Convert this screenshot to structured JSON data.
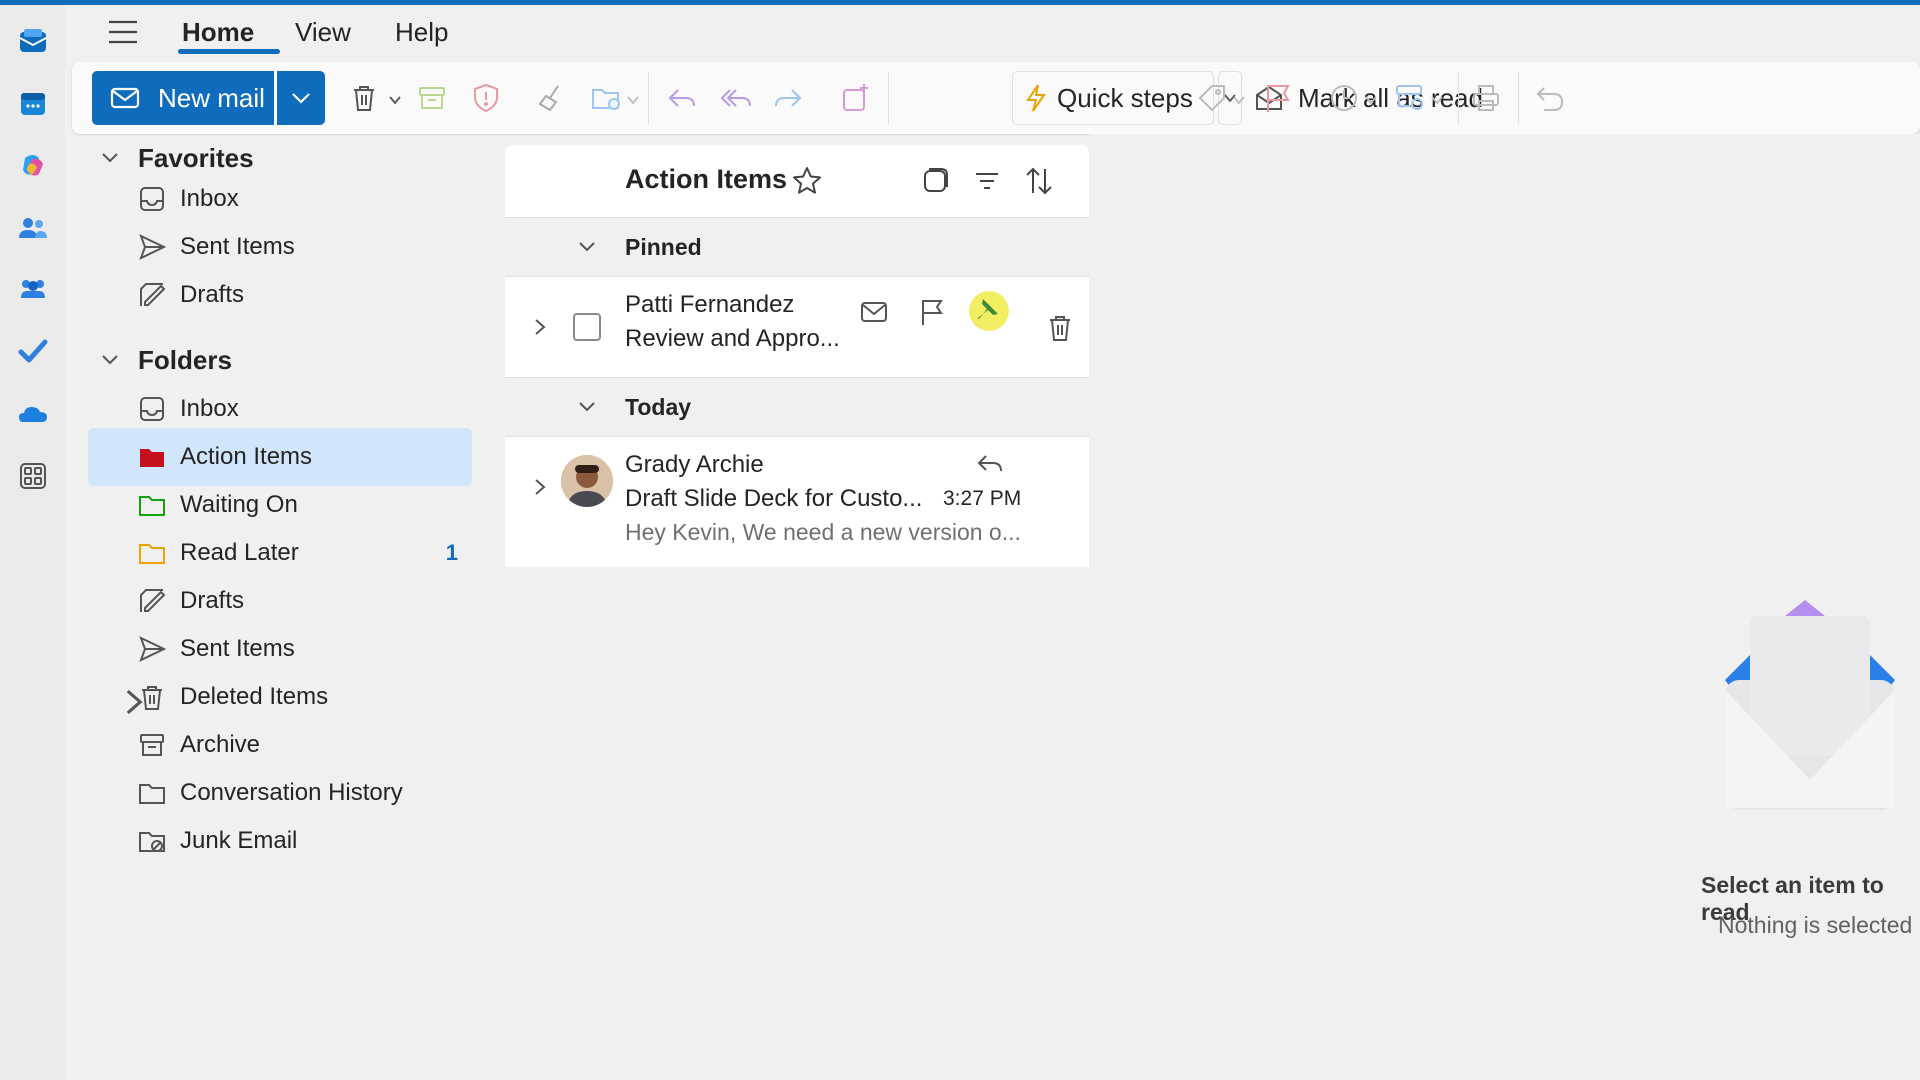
{
  "colors": {
    "accent": "#0f6cbd",
    "selected_bg": "#d1e5fb",
    "action_folder": "#c50f1f",
    "waiting_folder": "#13a10e",
    "later_folder": "#eaa300"
  },
  "rail": {
    "apps": [
      "mail-icon",
      "calendar-icon",
      "copilot-icon",
      "people-icon",
      "teams-icon",
      "todo-icon",
      "onedrive-icon",
      "more-apps-icon"
    ]
  },
  "header": {
    "tabs": [
      {
        "label": "Home",
        "active": true
      },
      {
        "label": "View",
        "active": false
      },
      {
        "label": "Help",
        "active": false
      }
    ]
  },
  "ribbon": {
    "new_mail_label": "New mail",
    "quick_steps_label": "Quick steps",
    "mark_all_read_label": "Mark all as read"
  },
  "favorites": {
    "header": "Favorites",
    "items": [
      {
        "label": "Inbox",
        "icon": "inbox-icon"
      },
      {
        "label": "Sent Items",
        "icon": "send-icon"
      },
      {
        "label": "Drafts",
        "icon": "drafts-icon"
      }
    ]
  },
  "folders": {
    "header": "Folders",
    "items": [
      {
        "label": "Inbox",
        "icon": "inbox-icon"
      },
      {
        "label": "Action Items",
        "icon": "folder-icon",
        "selected": true
      },
      {
        "label": "Waiting On",
        "icon": "folder-icon"
      },
      {
        "label": "Read Later",
        "icon": "folder-icon",
        "count": "1"
      },
      {
        "label": "Drafts",
        "icon": "drafts-icon"
      },
      {
        "label": "Sent Items",
        "icon": "send-icon"
      },
      {
        "label": "Deleted Items",
        "icon": "trash-icon"
      },
      {
        "label": "Archive",
        "icon": "archive-icon"
      },
      {
        "label": "Conversation History",
        "icon": "folder-icon"
      },
      {
        "label": "Junk Email",
        "icon": "junk-icon"
      }
    ]
  },
  "message_list": {
    "title": "Action Items",
    "sections": [
      {
        "label": "Pinned",
        "messages": [
          {
            "sender": "Patti Fernandez",
            "subject": "Review and Appro..."
          }
        ]
      },
      {
        "label": "Today",
        "messages": [
          {
            "sender": "Grady Archie",
            "subject": "Draft Slide Deck for Custo...",
            "time": "3:27 PM",
            "preview": "Hey Kevin, We need a new version o..."
          }
        ]
      }
    ]
  },
  "reading_pane": {
    "empty_title": "Select an item to read",
    "empty_subtitle": "Nothing is selected"
  }
}
